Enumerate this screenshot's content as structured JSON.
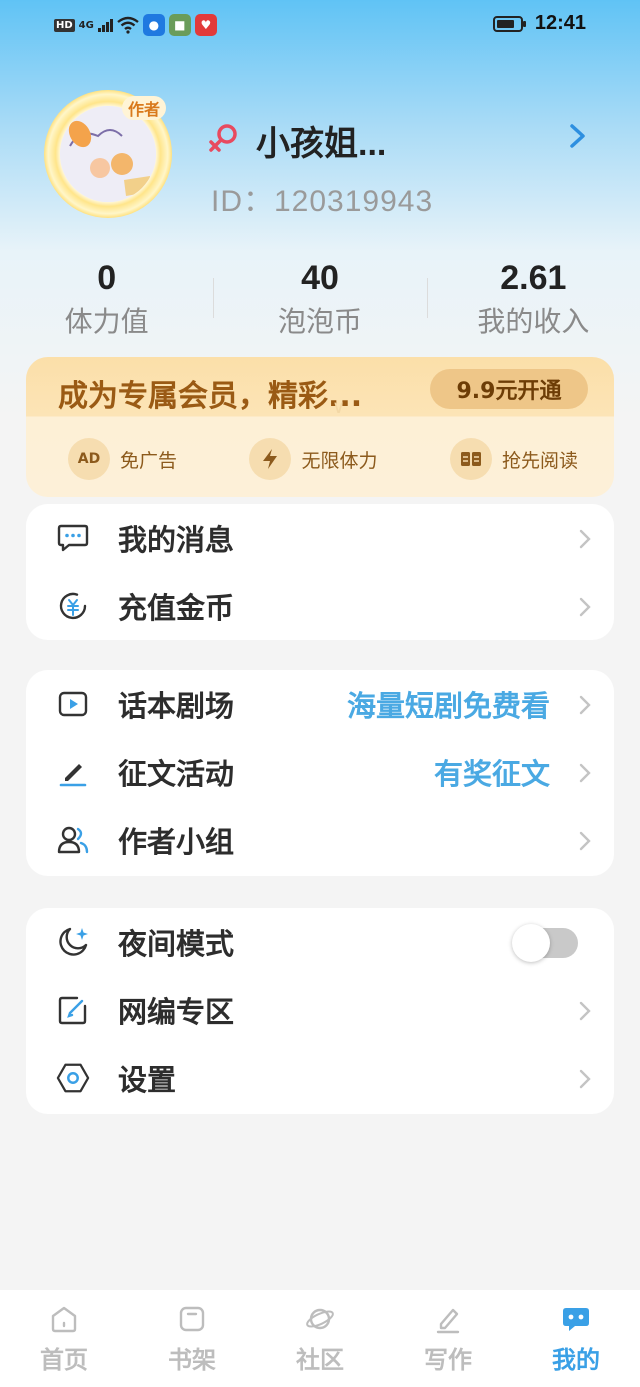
{
  "status_bar": {
    "network_hd": "HD",
    "network_type": "4G",
    "time": "12:41",
    "battery_level": 0.75
  },
  "profile": {
    "avatar_tag": "作者",
    "username": "小孩姐...",
    "user_id": "ID：120319943"
  },
  "stats": [
    {
      "value": "0",
      "label": "体力值"
    },
    {
      "value": "40",
      "label": "泡泡币"
    },
    {
      "value": "2.61",
      "label": "我的收入"
    }
  ],
  "vip": {
    "title": "成为专属会员，精彩...",
    "button_label": "9.9元开通",
    "perks": [
      {
        "icon": "ad-icon",
        "icon_text": "AD",
        "label": "免广告"
      },
      {
        "icon": "lightning-icon",
        "label": "无限体力"
      },
      {
        "icon": "book-icon",
        "label": "抢先阅读"
      }
    ]
  },
  "menu_group_1": [
    {
      "label": "我的消息",
      "icon": "message-icon"
    },
    {
      "label": "充值金币",
      "icon": "coin-icon"
    }
  ],
  "menu_group_2": [
    {
      "label": "话本剧场",
      "extra": "海量短剧免费看",
      "icon": "play-icon"
    },
    {
      "label": "征文活动",
      "extra": "有奖征文",
      "icon": "pen-icon"
    },
    {
      "label": "作者小组",
      "icon": "group-icon"
    }
  ],
  "menu_group_3": [
    {
      "label": "夜间模式",
      "icon": "moon-icon",
      "toggle": false
    },
    {
      "label": "网编专区",
      "icon": "edit-icon"
    },
    {
      "label": "设置",
      "icon": "settings-icon"
    }
  ],
  "bottom_nav": [
    {
      "label": "首页",
      "icon": "home-icon",
      "active": false
    },
    {
      "label": "书架",
      "icon": "bookshelf-icon",
      "active": false
    },
    {
      "label": "社区",
      "icon": "planet-icon",
      "active": false
    },
    {
      "label": "写作",
      "icon": "write-icon",
      "active": false
    },
    {
      "label": "我的",
      "icon": "profile-chat-icon",
      "active": true
    }
  ],
  "colors": {
    "accent": "#3aa0e6",
    "vip_text": "#9a5a14",
    "gender": "#e84a5f"
  }
}
